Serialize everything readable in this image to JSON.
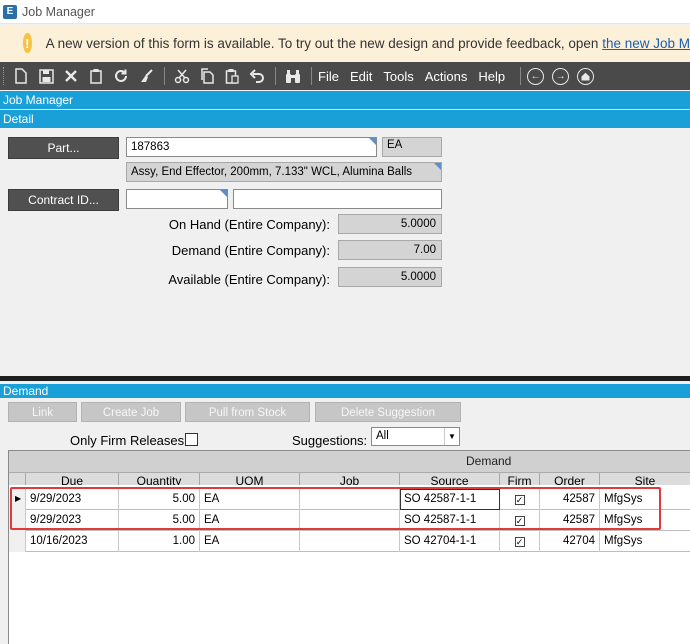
{
  "window": {
    "title": "Job Manager",
    "logo_letter": "E"
  },
  "banner": {
    "icon": "info-icon",
    "icon_glyph": "!",
    "text": "A new version of this form is available. To try out the new design and provide feedback, open ",
    "link_text": "the new Job M"
  },
  "toolbar": {
    "menus": [
      "File",
      "Edit",
      "Tools",
      "Actions",
      "Help"
    ]
  },
  "sections": {
    "job_manager": "Job Manager",
    "detail": "Detail",
    "demand": "Demand"
  },
  "detail": {
    "part_button": "Part...",
    "part_value": "187863",
    "uom_value": "EA",
    "description": "Assy, End Effector, 200mm, 7.133\" WCL, Alumina Balls",
    "contract_button": "Contract ID...",
    "contract_value": "",
    "contract_desc": "",
    "on_hand_label": "On Hand (Entire Company):",
    "on_hand_value": "5.0000",
    "demand_label": "Demand (Entire Company):",
    "demand_value": "7.00",
    "available_label": "Available (Entire Company):",
    "available_value": "5.0000"
  },
  "demand": {
    "buttons": [
      "Link",
      "Create Job",
      "Pull from Stock",
      "Delete Suggestion"
    ],
    "only_firm_label": "Only Firm Releases",
    "only_firm_checked": false,
    "suggestions_label": "Suggestions:",
    "suggestions_value": "All",
    "grid_group": "Demand",
    "columns": [
      "Due",
      "Quantity",
      "UOM",
      "Job",
      "Source",
      "Firm",
      "Order",
      "Site"
    ],
    "rows": [
      {
        "due": "9/29/2023",
        "quantity": "5.00",
        "uom": "EA",
        "job": "",
        "source": "SO 42587-1-1",
        "firm": true,
        "order": "42587",
        "site": "MfgSys",
        "current": true
      },
      {
        "due": "9/29/2023",
        "quantity": "5.00",
        "uom": "EA",
        "job": "",
        "source": "SO 42587-1-1",
        "firm": true,
        "order": "42587",
        "site": "MfgSys",
        "current": false
      },
      {
        "due": "10/16/2023",
        "quantity": "1.00",
        "uom": "EA",
        "job": "",
        "source": "SO 42704-1-1",
        "firm": true,
        "order": "42704",
        "site": "MfgSys",
        "current": false
      }
    ]
  },
  "colors": {
    "section_bar": "#1aa0d8",
    "toolbar": "#4a4a4a",
    "highlight": "#e03a3a",
    "banner_bg": "#fdf0d8"
  }
}
